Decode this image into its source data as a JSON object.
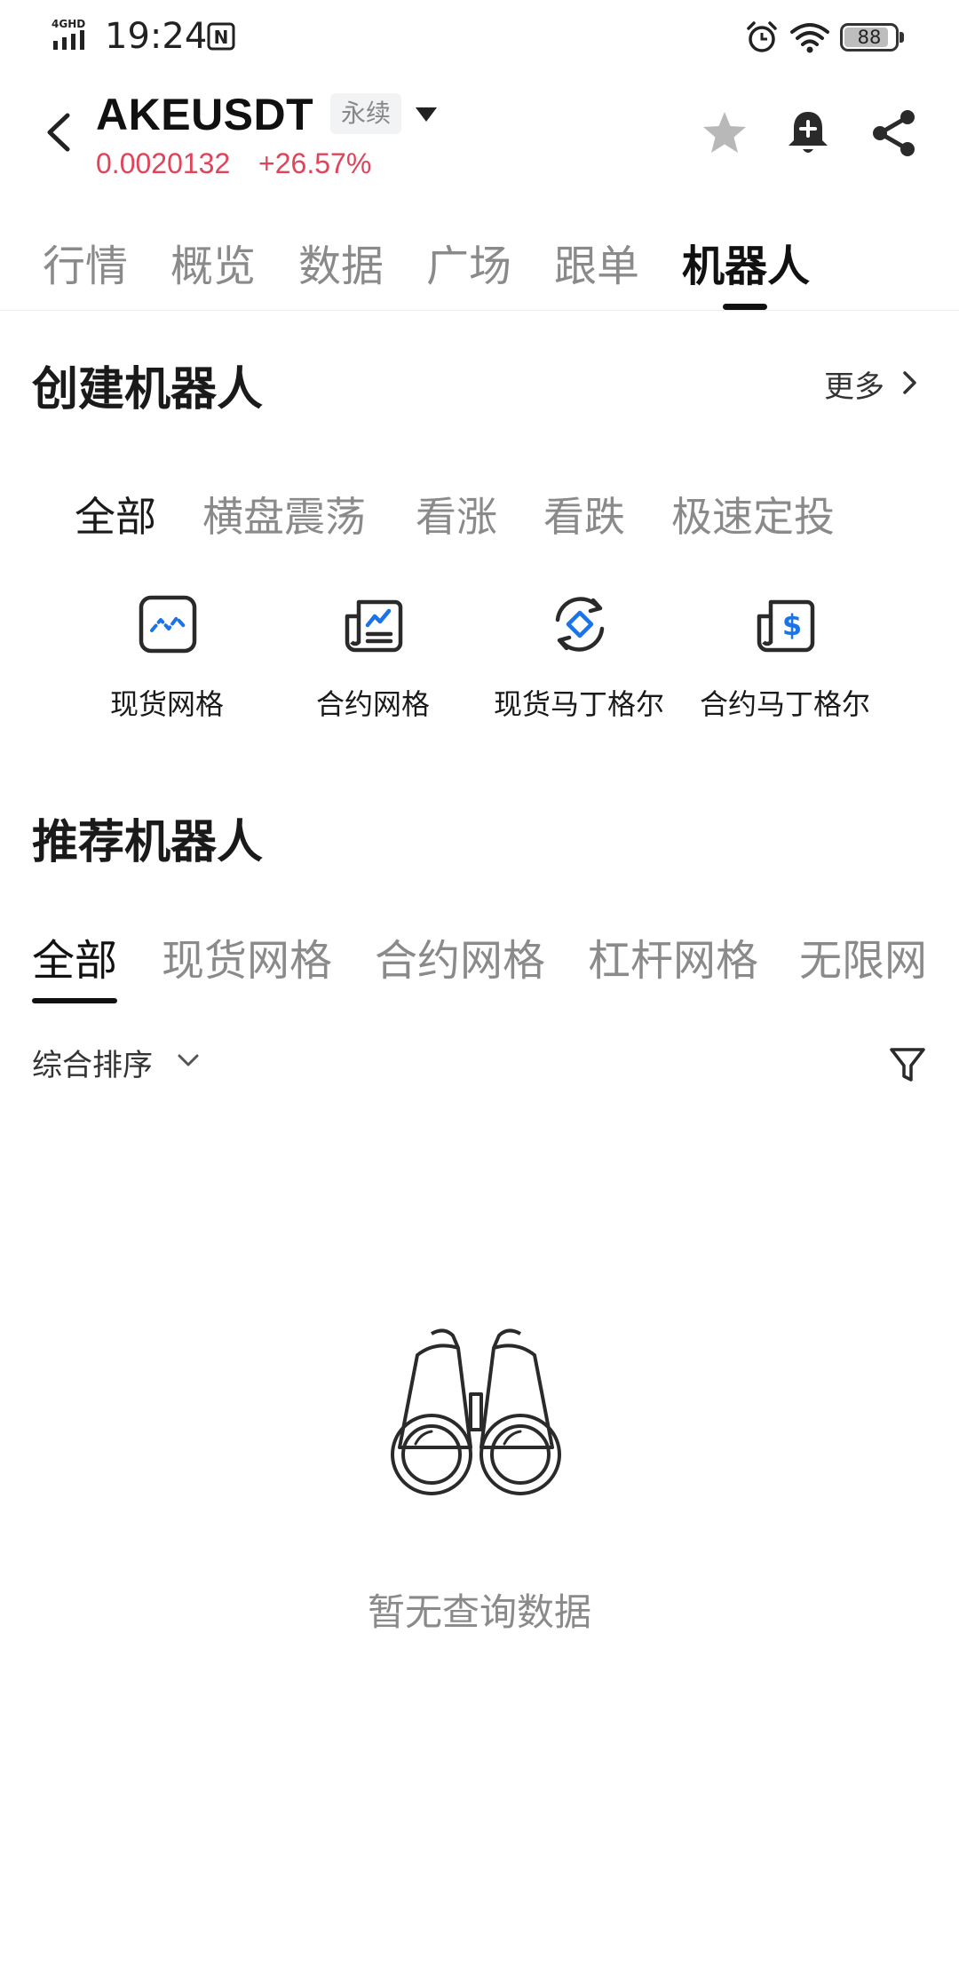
{
  "status_bar": {
    "network": "4GHD",
    "time": "19:24",
    "battery": "88",
    "battery_level": 0.88
  },
  "header": {
    "symbol": "AKEUSDT",
    "contract_type": "永续",
    "price": "0.0020132",
    "change": "+26.57%"
  },
  "main_tabs": [
    {
      "label": "行情",
      "active": false
    },
    {
      "label": "概览",
      "active": false
    },
    {
      "label": "数据",
      "active": false
    },
    {
      "label": "广场",
      "active": false
    },
    {
      "label": "跟单",
      "active": false
    },
    {
      "label": "机器人",
      "active": true
    }
  ],
  "create_section": {
    "title": "创建机器人",
    "more_label": "更多",
    "filters": [
      {
        "label": "全部",
        "active": true
      },
      {
        "label": "横盘震荡",
        "active": false
      },
      {
        "label": "看涨",
        "active": false
      },
      {
        "label": "看跌",
        "active": false
      },
      {
        "label": "极速定投",
        "active": false
      }
    ],
    "bot_types": [
      {
        "label": "现货网格",
        "icon": "spot-grid-icon"
      },
      {
        "label": "合约网格",
        "icon": "futures-grid-icon"
      },
      {
        "label": "现货马丁格尔",
        "icon": "spot-martingale-icon"
      },
      {
        "label": "合约马丁格尔",
        "icon": "futures-martingale-icon"
      }
    ]
  },
  "recommend_section": {
    "title": "推荐机器人",
    "tabs": [
      {
        "label": "全部",
        "active": true
      },
      {
        "label": "现货网格",
        "active": false
      },
      {
        "label": "合约网格",
        "active": false
      },
      {
        "label": "杠杆网格",
        "active": false
      },
      {
        "label": "无限网",
        "active": false
      }
    ],
    "sort_label": "综合排序",
    "empty_text": "暂无查询数据"
  },
  "colors": {
    "price_red": "#e0445a",
    "accent_blue": "#1a73e8",
    "inactive_gray": "#8a8a8a"
  }
}
